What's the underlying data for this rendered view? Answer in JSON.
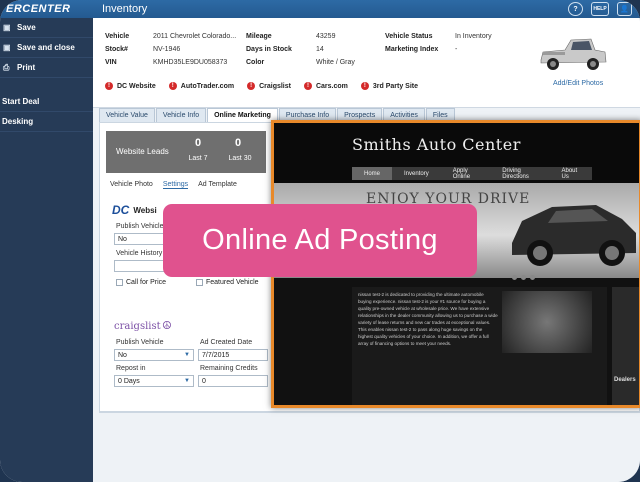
{
  "topbar": {
    "brand": "ERCENTER",
    "title": "Inventory",
    "icons": [
      {
        "name": "help-icon",
        "glyph": "?"
      },
      {
        "name": "help-label-icon",
        "glyph": "HELP"
      },
      {
        "name": "user-icon",
        "glyph": "👤"
      }
    ]
  },
  "sidebar": {
    "items": [
      {
        "label": "Save",
        "icon": "save-icon",
        "glyph": "▣"
      },
      {
        "label": "Save and close",
        "icon": "save-close-icon",
        "glyph": "▣"
      },
      {
        "label": "Print",
        "icon": "print-icon",
        "glyph": "⎙"
      }
    ],
    "extra": [
      {
        "label": "Start Deal"
      },
      {
        "label": "Desking"
      }
    ]
  },
  "vehicle": {
    "vehicle_label": "Vehicle",
    "vehicle_value": "2011 Chevrolet Colorado...",
    "stock_label": "Stock#",
    "stock_value": "NV-1946",
    "vin_label": "VIN",
    "vin_value": "KMHD35LE9DU058373",
    "mileage_label": "Mileage",
    "mileage_value": "43259",
    "days_label": "Days in Stock",
    "days_value": "14",
    "color_label": "Color",
    "color_value": "White / Gray",
    "status_label": "Vehicle Status",
    "status_value": "In Inventory",
    "index_label": "Marketing Index",
    "index_value": "-"
  },
  "links": [
    {
      "label": "DC Website"
    },
    {
      "label": "AutoTrader.com"
    },
    {
      "label": "Craigslist"
    },
    {
      "label": "Cars.com"
    },
    {
      "label": "3rd Party Site"
    }
  ],
  "add_edit_photos": "Add/Edit Photos",
  "tabs": [
    {
      "label": "Vehicle Value",
      "active": false
    },
    {
      "label": "Vehicle Info",
      "active": false
    },
    {
      "label": "Online Marketing",
      "active": true
    },
    {
      "label": "Purchase Info",
      "active": false
    },
    {
      "label": "Prospects",
      "active": false
    },
    {
      "label": "Activities",
      "active": false
    },
    {
      "label": "Files",
      "active": false
    }
  ],
  "leads": {
    "title": "Website Leads",
    "last7_value": "0",
    "last7_label": "Last 7",
    "last30_value": "0",
    "last30_label": "Last 30"
  },
  "subtabs": {
    "photo": "Vehicle Photo",
    "settings": "Settings",
    "template": "Ad Template"
  },
  "dc_section": {
    "logo": "DC",
    "title": "Websi",
    "publish_label": "Publish Vehicle",
    "publish_value": "No",
    "history_label": "Vehicle History",
    "call_for_price": "Call for Price",
    "featured_vehicle": "Featured Vehicle"
  },
  "craigslist": {
    "logo": "craigslist",
    "peace": "☮",
    "publish_label": "Publish Vehicle",
    "publish_value": "No",
    "created_label": "Ad Created Date",
    "created_value": "7/7/2015",
    "repost_label": "Repost in",
    "repost_value": "0 Days",
    "credits_label": "Remaining Credits",
    "credits_value": "0"
  },
  "preview": {
    "title": "Smiths Auto Center",
    "nav": [
      "Home",
      "Inventory",
      "Apply Online",
      "Driving Directions",
      "About Us"
    ],
    "hero_text": "ENJOY YOUR DRIVE",
    "body_text": "nissan test-2 is dedicated to providing the ultimate automobile buying experience. nissan test-2 is your #1 source for buying a quality pre-owned vehicle at wholesale price. We have extensive relationships in the dealer community allowing us to purchase a wide variety of lease returns and new car trades at exceptional values. This enables nissan test-2 to pass along huge savings on the highest quality vehicles of your choice. In addition, we offer a full array of financing options to meet your needs.",
    "side_label": "Dealers"
  },
  "badge": "Online Ad Posting"
}
